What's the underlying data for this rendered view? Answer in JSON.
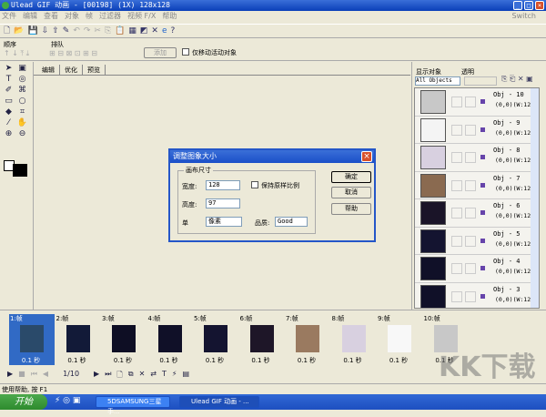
{
  "window": {
    "title": "Ulead GIF 动画 - [00198] (1X) 128x128"
  },
  "menu": [
    "文件",
    "编辑",
    "查看",
    "对象",
    "帧",
    "过滤器",
    "视频 F/X",
    "帮助"
  ],
  "menu_right": "Switch",
  "toolbar2": {
    "order_label": "顺序",
    "queue_label": "排队",
    "apply_button": "添加",
    "only_move_active": "仅移动活动对象"
  },
  "canvas_tabs": [
    "编辑",
    "优化",
    "预览"
  ],
  "right_panel": {
    "show_objects_label": "显示对象",
    "transparent_label": "透明",
    "show_objects_value": "All Objects",
    "objects": [
      {
        "name": "Obj - 10",
        "pos": "(0,0)(W:128,H:",
        "thumb": "#c8c8c8"
      },
      {
        "name": "Obj - 9",
        "pos": "(0,0)(W:128,H:",
        "thumb": "#f4f4f4"
      },
      {
        "name": "Obj - 8",
        "pos": "(0,0)(W:128,H:",
        "thumb": "#d8d0e0"
      },
      {
        "name": "Obj - 7",
        "pos": "(0,0)(W:128,H:",
        "thumb": "#8a6a50"
      },
      {
        "name": "Obj - 6",
        "pos": "(0,0)(W:128,H:",
        "thumb": "#1a1428"
      },
      {
        "name": "Obj - 5",
        "pos": "(0,0)(W:128,H:",
        "thumb": "#141430"
      },
      {
        "name": "Obj - 4",
        "pos": "(0,0)(W:128,H:",
        "thumb": "#101028"
      },
      {
        "name": "Obj - 3",
        "pos": "(0,0)(W:128,H:",
        "thumb": "#101028"
      }
    ]
  },
  "dialog": {
    "title": "调整图象大小",
    "group_label": "画布尺寸",
    "width_label": "宽度:",
    "width_value": "128",
    "height_label": "高度:",
    "height_value": "97",
    "keep_ratio_label": "保持原样比例",
    "unit_label": "单",
    "unit_value": "像素",
    "quality_label": "品质:",
    "quality_value": "Good",
    "ok": "确定",
    "cancel": "取消",
    "help": "帮助"
  },
  "frames": [
    {
      "label": "1:帧",
      "delay": "0.1 秒",
      "thumb": "#2a4a6a"
    },
    {
      "label": "2:帧",
      "delay": "0.1 秒",
      "thumb": "#121a38"
    },
    {
      "label": "3:帧",
      "delay": "0.1 秒",
      "thumb": "#0e0e24"
    },
    {
      "label": "4:帧",
      "delay": "0.1 秒",
      "thumb": "#101028"
    },
    {
      "label": "5:帧",
      "delay": "0.1 秒",
      "thumb": "#141430"
    },
    {
      "label": "6:帧",
      "delay": "0.1 秒",
      "thumb": "#1e1628"
    },
    {
      "label": "7:帧",
      "delay": "0.1 秒",
      "thumb": "#9a7a60"
    },
    {
      "label": "8:帧",
      "delay": "0.1 秒",
      "thumb": "#d8d0e0"
    },
    {
      "label": "9:帧",
      "delay": "0.1 秒",
      "thumb": "#f8f8f8"
    },
    {
      "label": "10:帧",
      "delay": "0.1 秒",
      "thumb": "#c8c8c8"
    }
  ],
  "playback": {
    "counter": "1/10"
  },
  "status": "使用帮助, 按 F1",
  "taskbar": {
    "start": "开始",
    "tasks": [
      "5DSAMSUNG三星手...",
      "Ulead GIF 动画 - ..."
    ]
  },
  "watermark": "KK下载"
}
